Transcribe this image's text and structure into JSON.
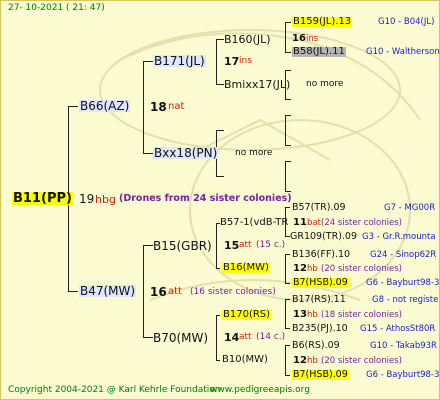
{
  "header": {
    "timestamp": "27-  10-2021  ( 21: 47)"
  },
  "footer": {
    "copyright": "Copyright 2004-2021 @ Karl Kehrle Foundation",
    "url": "www.pedigreeapis.org"
  },
  "queen": {
    "code": "B11(PP)",
    "year": "19",
    "type": "hbg",
    "note": "(Drones from 24 sister colonies)"
  },
  "sire_side": {
    "queen": "B66(AZ)",
    "year": "18",
    "type": "nat",
    "upper": {
      "queen": "B171(JL)",
      "year": "17",
      "type": "ins",
      "upper": {
        "queen": "B160(JL)",
        "year": "16",
        "type": "ins",
        "upper": {
          "code": "B159(JL).13",
          "info": "G10 - B04(JL)"
        },
        "lower": {
          "code": "B58(JL).11",
          "info": "G10 - Waltherson"
        }
      },
      "lower": {
        "queen": "Bmixx17(JL)",
        "more": "no more"
      }
    },
    "lower": {
      "queen": "Bxx18(PN)",
      "more": "no more"
    }
  },
  "dam_side": {
    "queen": "B47(MW)",
    "year": "16",
    "type": "att",
    "note": "(16 sister colonies)",
    "upper": {
      "queen": "B15(GBR)",
      "year": "15",
      "type": "att",
      "note": "(15 c.)",
      "upper": {
        "queen": "B57-1(vdB-TR",
        "year": "11",
        "type": "bat",
        "note": "(24 sister colonies)",
        "upper": {
          "code": "B57(TR).09",
          "info": "G7 - MG00R"
        },
        "lower": {
          "code": "GR109(TR).09",
          "info": "G3 - Gr.R.mounta"
        }
      },
      "lower": {
        "queen": "B16(MW)",
        "year": "12",
        "type": "hb",
        "note": "(20 sister colonies)",
        "upper": {
          "code": "B136(FF).10",
          "info": "G24 - Sinop62R"
        },
        "lower": {
          "code": "B7(HSB).09",
          "info": "G6 - Bayburt98-3"
        }
      }
    },
    "lower": {
      "queen": "B70(MW)",
      "year": "14",
      "type": "att",
      "note": "(14 c.)",
      "upper": {
        "queen": "B170(RS)",
        "year": "13",
        "type": "hb",
        "note": "(18 sister colonies)",
        "upper": {
          "code": "B17(RS).11",
          "info": "G8 - not registe"
        },
        "lower": {
          "code": "B235(PJ).10",
          "info": "G15 - AthosSt80R"
        }
      },
      "lower": {
        "queen": "B10(MW)",
        "year": "12",
        "type": "hb",
        "note": "(20 sister colonies)",
        "upper": {
          "code": "B6(RS).09",
          "info": "G10 - Takab93R"
        },
        "lower": {
          "code": "B7(HSB).09",
          "info": "G6 - Bayburt98-3"
        }
      }
    }
  }
}
